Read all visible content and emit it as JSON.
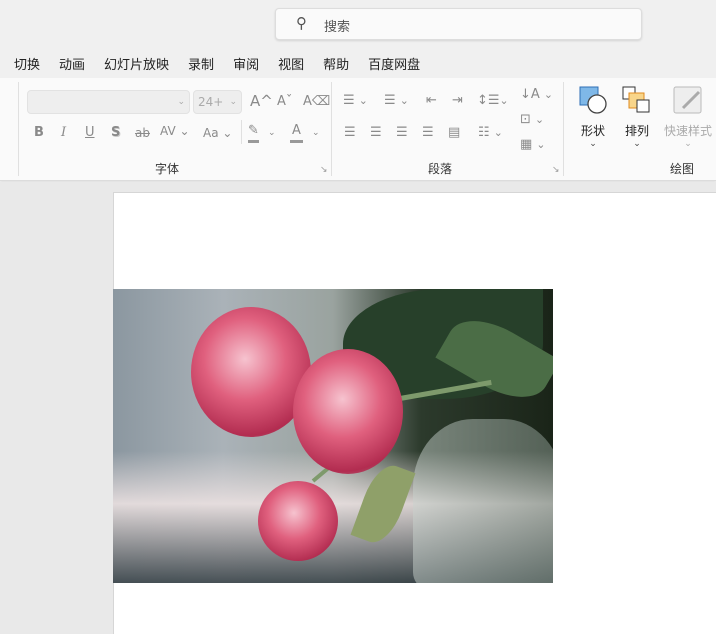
{
  "search": {
    "placeholder": "搜索",
    "icon": "search-icon"
  },
  "tabs": [
    "切换",
    "动画",
    "幻灯片放映",
    "录制",
    "审阅",
    "视图",
    "帮助",
    "百度网盘"
  ],
  "font_group": {
    "label": "字体",
    "font_name": "",
    "font_size": "24+",
    "buttons": {
      "grow": "A^",
      "shrink": "Aˇ",
      "clear": "A⌫",
      "bold": "B",
      "italic": "I",
      "underline": "U",
      "shadow": "S",
      "strike": "ab",
      "spacing": "AV",
      "case": "Aa",
      "highlight": "✎",
      "color": "A"
    }
  },
  "paragraph_group": {
    "label": "段落"
  },
  "drawing_group": {
    "label": "绘图",
    "shapes": "形状",
    "arrange": "排列",
    "quick_styles": "快速样式"
  },
  "colors": {
    "shape_fill": "#7fb8e8",
    "arrange_fill": "#f8d58a",
    "arrange_border": "#e08a1e"
  }
}
